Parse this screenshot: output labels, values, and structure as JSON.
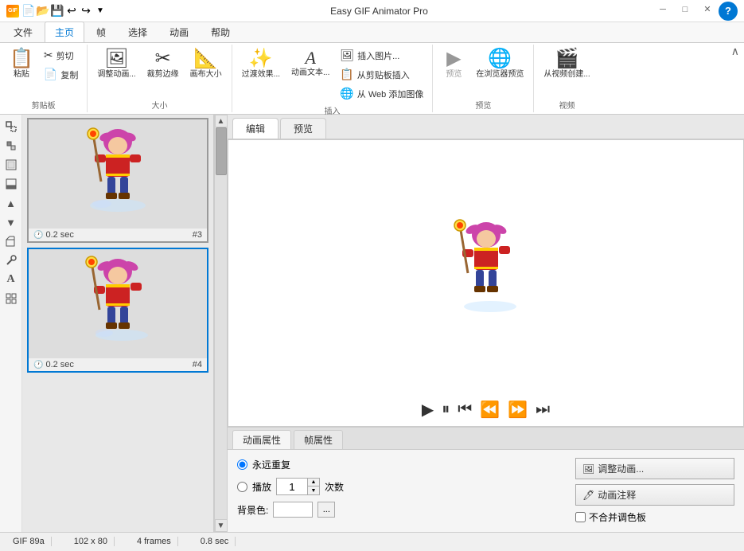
{
  "app": {
    "title": "Easy GIF Animator Pro",
    "icon_label": "GIF"
  },
  "title_bar": {
    "toolbar_icons": [
      "new",
      "open",
      "save",
      "undo",
      "redo"
    ],
    "window_controls": [
      "minimize",
      "maximize",
      "close"
    ]
  },
  "ribbon": {
    "tabs": [
      {
        "id": "file",
        "label": "文件",
        "active": false
      },
      {
        "id": "home",
        "label": "主页",
        "active": true
      },
      {
        "id": "frame",
        "label": "帧",
        "active": false
      },
      {
        "id": "select",
        "label": "选择",
        "active": false
      },
      {
        "id": "animation",
        "label": "动画",
        "active": false
      },
      {
        "id": "help",
        "label": "帮助",
        "active": false
      }
    ],
    "groups": {
      "clipboard": {
        "label": "剪贴板",
        "paste": "粘贴",
        "cut": "✂ 剪切",
        "copy": "复制"
      },
      "size": {
        "label": "大小",
        "resize": "调整动画...",
        "crop": "裁剪边缘",
        "canvas": "画布大小"
      },
      "insert": {
        "label": "插入",
        "effects": "过渡效果...",
        "text": "动画文本...",
        "insert_img": "插入图片...",
        "from_clipboard": "从剪贴板插入",
        "from_web": "从 Web 添加图像"
      },
      "preview": {
        "label": "预览",
        "preview": "预览",
        "browser_preview": "在浏览器预览"
      },
      "video": {
        "label": "视频",
        "from_video": "从视频创建..."
      }
    }
  },
  "left_toolbar": {
    "tools": [
      {
        "id": "select",
        "icon": "⬛",
        "label": "选择工具"
      },
      {
        "id": "draw",
        "icon": "✏",
        "label": "绘制工具"
      },
      {
        "id": "fill",
        "icon": "⬜",
        "label": "填充工具"
      },
      {
        "id": "text",
        "icon": "⬜",
        "label": "文字工具"
      },
      {
        "id": "up",
        "icon": "▲",
        "label": "上移"
      },
      {
        "id": "down",
        "icon": "▼",
        "label": "下移"
      },
      {
        "id": "zoom",
        "icon": "⬜",
        "label": "缩放"
      },
      {
        "id": "eyedrop",
        "icon": "⬜",
        "label": "取色器"
      },
      {
        "id": "typeA",
        "icon": "A",
        "label": "文字"
      },
      {
        "id": "grid",
        "icon": "⊞",
        "label": "网格"
      }
    ]
  },
  "frames": [
    {
      "id": 3,
      "time": "0.2 sec",
      "label": "#3",
      "selected": false
    },
    {
      "id": 4,
      "time": "0.2 sec",
      "label": "#4",
      "selected": true
    }
  ],
  "editor": {
    "tabs": [
      {
        "id": "edit",
        "label": "编辑",
        "active": true
      },
      {
        "id": "preview",
        "label": "预览",
        "active": false
      }
    ]
  },
  "properties": {
    "tabs": [
      {
        "id": "animation",
        "label": "动画属性",
        "active": true
      },
      {
        "id": "frame",
        "label": "帧属性",
        "active": false
      }
    ],
    "repeat_forever": true,
    "play_count": "1",
    "play_count_label": "次数",
    "bg_color_label": "背景色:",
    "play_label": "播放",
    "adjust_btn": "调整动画...",
    "comment_btn": "动画注释",
    "no_merge_palette": "不合并调色板"
  },
  "status_bar": {
    "format": "GIF 89a",
    "dimensions": "102 x 80",
    "frames": "4 frames",
    "duration": "0.8 sec"
  },
  "playback": {
    "play": "▶",
    "pause": "⏸",
    "skip_start": "⏮",
    "prev": "⏪",
    "next": "⏩",
    "skip_end": "⏭"
  },
  "colors": {
    "active_tab": "#0078d4",
    "ribbon_bg": "#ffffff",
    "accent": "#0078d4",
    "frame_selected_border": "#0078d4"
  }
}
